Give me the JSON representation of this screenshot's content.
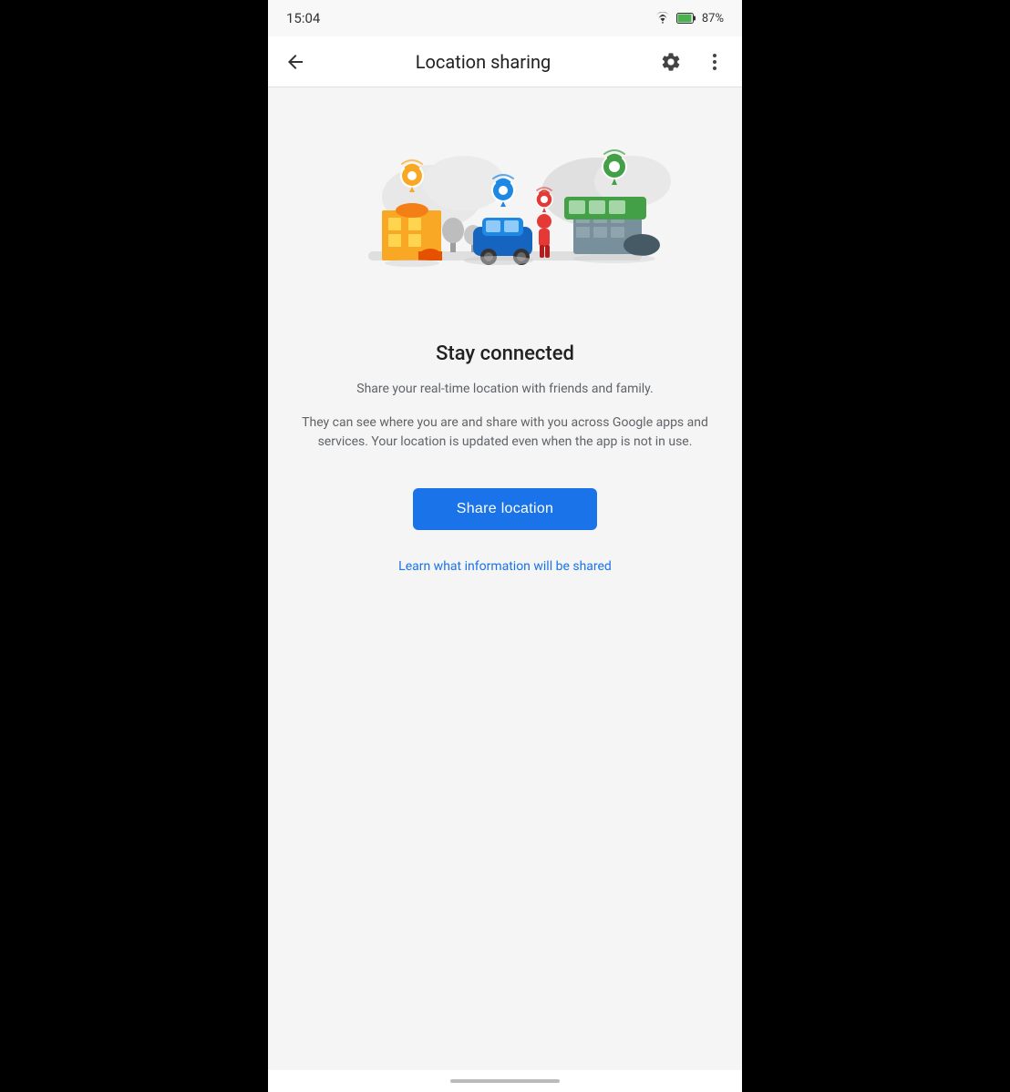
{
  "status_bar": {
    "time": "15:04",
    "battery_percent": "87%"
  },
  "app_bar": {
    "title": "Location sharing",
    "back_label": "Back",
    "settings_label": "Settings",
    "more_label": "More options"
  },
  "content": {
    "heading": "Stay connected",
    "description_1": "Share your real-time location with friends and family.",
    "description_2": "They can see where you are and share with you across Google apps and services. Your location is updated even when the app is not in use.",
    "share_button_label": "Share location",
    "learn_link_label": "Learn what information will be shared"
  }
}
